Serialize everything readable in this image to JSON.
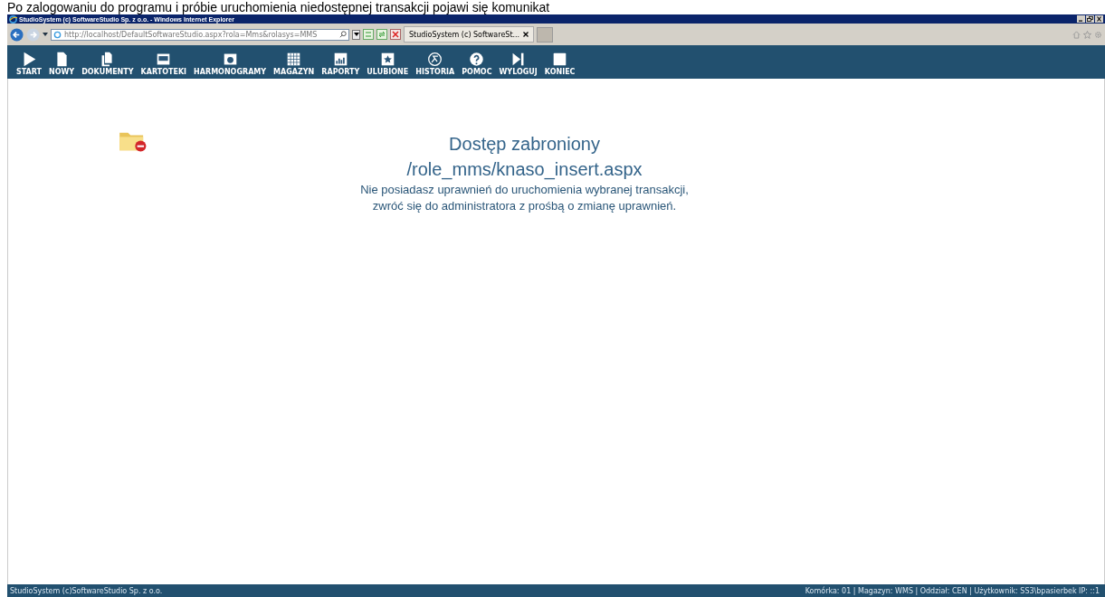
{
  "caption": "Po zalogowaniu do programu i próbie uruchomienia niedostępnej transakcji pojawi się komunikat",
  "window": {
    "title": "StudioSystem (c) SoftwareStudio Sp. z o.o. - Windows Internet Explorer"
  },
  "browser": {
    "address": "http://localhost/DefaultSoftwareStudio.aspx?rola=Mms&rolasys=MMS",
    "tabs": [
      {
        "label": "StudioSystem (c) SoftwareSt...",
        "selected": true
      }
    ]
  },
  "nav": [
    {
      "label": "START"
    },
    {
      "label": "NOWY"
    },
    {
      "label": "DOKUMENTY"
    },
    {
      "label": "KARTOTEKI"
    },
    {
      "label": "HARMONOGRAMY"
    },
    {
      "label": "MAGAZYN"
    },
    {
      "label": "RAPORTY"
    },
    {
      "label": "ULUBIONE"
    },
    {
      "label": "HISTORIA"
    },
    {
      "label": "POMOC"
    },
    {
      "label": "WYLOGUJ"
    },
    {
      "label": "KONIEC"
    }
  ],
  "message": {
    "title": "Dostęp zabroniony",
    "path": "/role_mms/knaso_insert.aspx",
    "lines": [
      "Nie posiadasz uprawnień do uruchomienia wybranej transakcji,",
      "zwróć się do administratora z prośbą o zmianę uprawnień."
    ]
  },
  "status_bar": {
    "left": "StudioSystem (c)SoftwareStudio Sp. z o.o.",
    "right": "Komórka: 01 | Magazyn: WMS | Oddział: CEN | Użytkownik: SS3\\bpasierbek IP: ::1"
  }
}
